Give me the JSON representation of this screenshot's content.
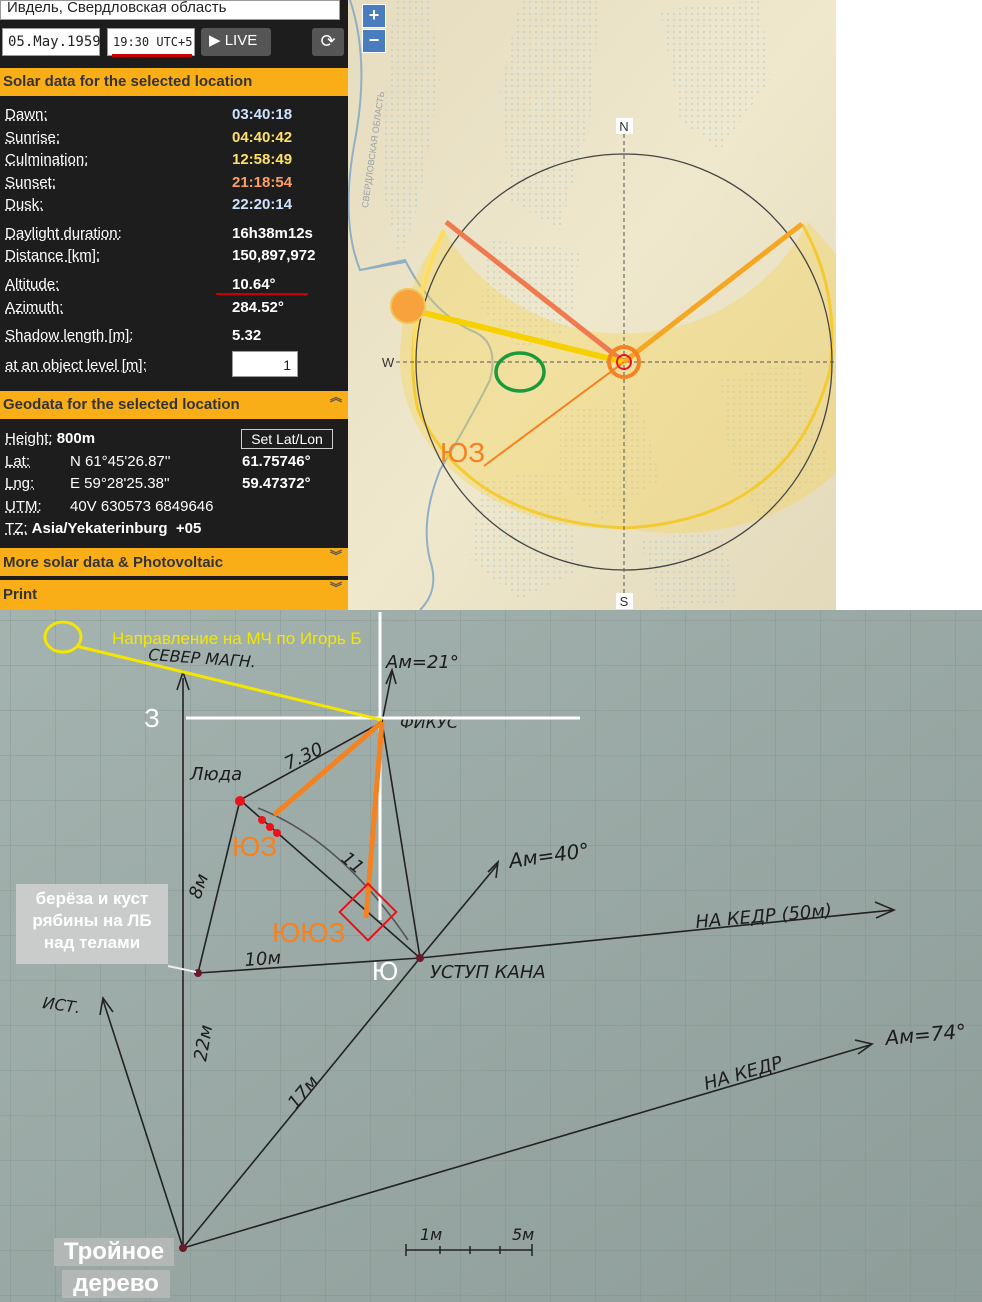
{
  "header": {
    "location": "Ивдель, Свердловская область",
    "date": "05.May.1959",
    "time": "19:30 UTC+5",
    "live_label": "LIVE"
  },
  "solar": {
    "title": "Solar data for the selected location",
    "rows": [
      {
        "label": "Dawn:",
        "value": "03:40:18",
        "color": "#cfe3ff"
      },
      {
        "label": "Sunrise:",
        "value": "04:40:42",
        "color": "#ffe066"
      },
      {
        "label": "Culmination:",
        "value": "12:58:49",
        "color": "#ffe066"
      },
      {
        "label": "Sunset:",
        "value": "21:18:54",
        "color": "#ff9f66"
      },
      {
        "label": "Dusk:",
        "value": "22:20:14",
        "color": "#cfe3ff"
      },
      {
        "label": "Daylight duration:",
        "value": "16h38m12s",
        "color": "#ffffff"
      },
      {
        "label": "Distance [km]:",
        "value": "150,897,972",
        "color": "#ffffff"
      },
      {
        "label": "Altitude:",
        "value": "10.64°",
        "color": "#ffffff"
      },
      {
        "label": "Azimuth:",
        "value": "284.52°",
        "color": "#ffffff"
      },
      {
        "label": "Shadow length [m]:",
        "value": "5.32",
        "color": "#ffffff"
      },
      {
        "label": "at an object level [m]:",
        "value": "",
        "color": "#ffffff"
      }
    ],
    "object_level": "1"
  },
  "geo": {
    "title": "Geodata for the selected location",
    "height_label": "Height:",
    "height": "800m",
    "set_label": "Set Lat/Lon",
    "lat_label": "Lat:",
    "lat_dms": "N 61°45'26.87''",
    "lat_dec": "61.75746°",
    "lng_label": "Lng:",
    "lng_dms": "E 59°28'25.38''",
    "lng_dec": "59.47372°",
    "utm_label": "UTM:",
    "utm": "40V 630573 6849646",
    "tz_label": "TZ:",
    "tz": "Asia/Yekaterinburg",
    "tz_offset": "+05"
  },
  "more_title": "More solar data & Photovoltaic",
  "print_title": "Print",
  "map": {
    "zoom_in": "+",
    "zoom_out": "−",
    "region_label": "СВЕРДЛОВСКАЯ ОБЛАСТЬ",
    "north": "N",
    "south": "S",
    "west": "W",
    "sw_label": "ЮЗ"
  },
  "sketch": {
    "direction_caption": "Направление на МЧ по Игорь Б",
    "west": "З",
    "south": "Ю",
    "sw1": "ЮЗ",
    "ssw": "ЮЮЗ",
    "box_birch": "берёза и куст рябины на ЛБ над телами",
    "box_tree_1": "Тройное",
    "box_tree_2": "дерево",
    "hand": {
      "north_magn": "СЕВЕР МАГН.",
      "am21": "Ам=21°",
      "fikus": "ФИКУС",
      "luda": "Люда",
      "d730": "7.30",
      "d8": "8м",
      "d11": "11",
      "am40": "Ам=40°",
      "kedr50": "НА КЕДР (50м)",
      "d10": "10м",
      "ustup": "УСТУП КАНА",
      "ist": "ИСТ.",
      "d22": "22м",
      "d17": "17м",
      "kedr": "НА КЕДР",
      "am74": "Ам=74°",
      "scale1": "1м",
      "scale5": "5м"
    }
  },
  "colors": {
    "accent": "#f9ae17",
    "orange": "#f58220",
    "yellow": "#ffe800",
    "red": "#e8141c",
    "green": "#1a9a3a"
  }
}
